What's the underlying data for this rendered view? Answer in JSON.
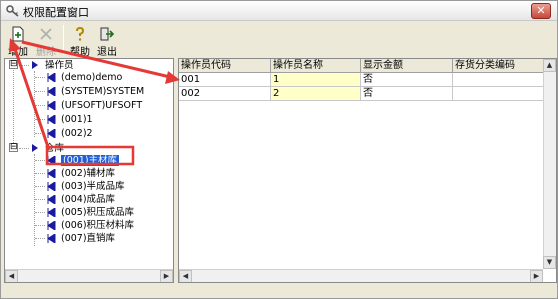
{
  "window": {
    "title": "权限配置窗口",
    "close_symbol": "✕"
  },
  "toolbar": {
    "buttons": [
      {
        "label": "增加",
        "icon": "add-icon",
        "enabled": true
      },
      {
        "label": "删除",
        "icon": "delete-icon",
        "enabled": false
      },
      {
        "label": "帮助",
        "icon": "help-icon",
        "enabled": true
      },
      {
        "label": "退出",
        "icon": "exit-icon",
        "enabled": true
      }
    ]
  },
  "tree": {
    "groups": [
      {
        "label": "操作员",
        "expander": "⊟",
        "children": [
          "(demo)demo",
          "(SYSTEM)SYSTEM",
          "(UFSOFT)UFSOFT",
          "(001)1",
          "(002)2"
        ]
      },
      {
        "label": "仓库",
        "expander": "⊟",
        "children": [
          "(001)主材库",
          "(002)辅材库",
          "(003)半成品库",
          "(004)成品库",
          "(005)积压成品库",
          "(006)积压材料库",
          "(007)直销库"
        ]
      }
    ],
    "selected": "(001)主材库"
  },
  "grid": {
    "columns": [
      "操作员代码",
      "操作员名称",
      "显示金额",
      "存货分类编码"
    ],
    "rows": [
      [
        "001",
        "1",
        "否",
        ""
      ],
      [
        "002",
        "2",
        "否",
        ""
      ]
    ]
  },
  "scroll": {
    "left": "◀",
    "right": "▶",
    "up": "▲",
    "down": "▼"
  },
  "colors": {
    "annotation": "#e53935",
    "selection": "#1e5fd7",
    "name_cell": "#ffffc8"
  }
}
